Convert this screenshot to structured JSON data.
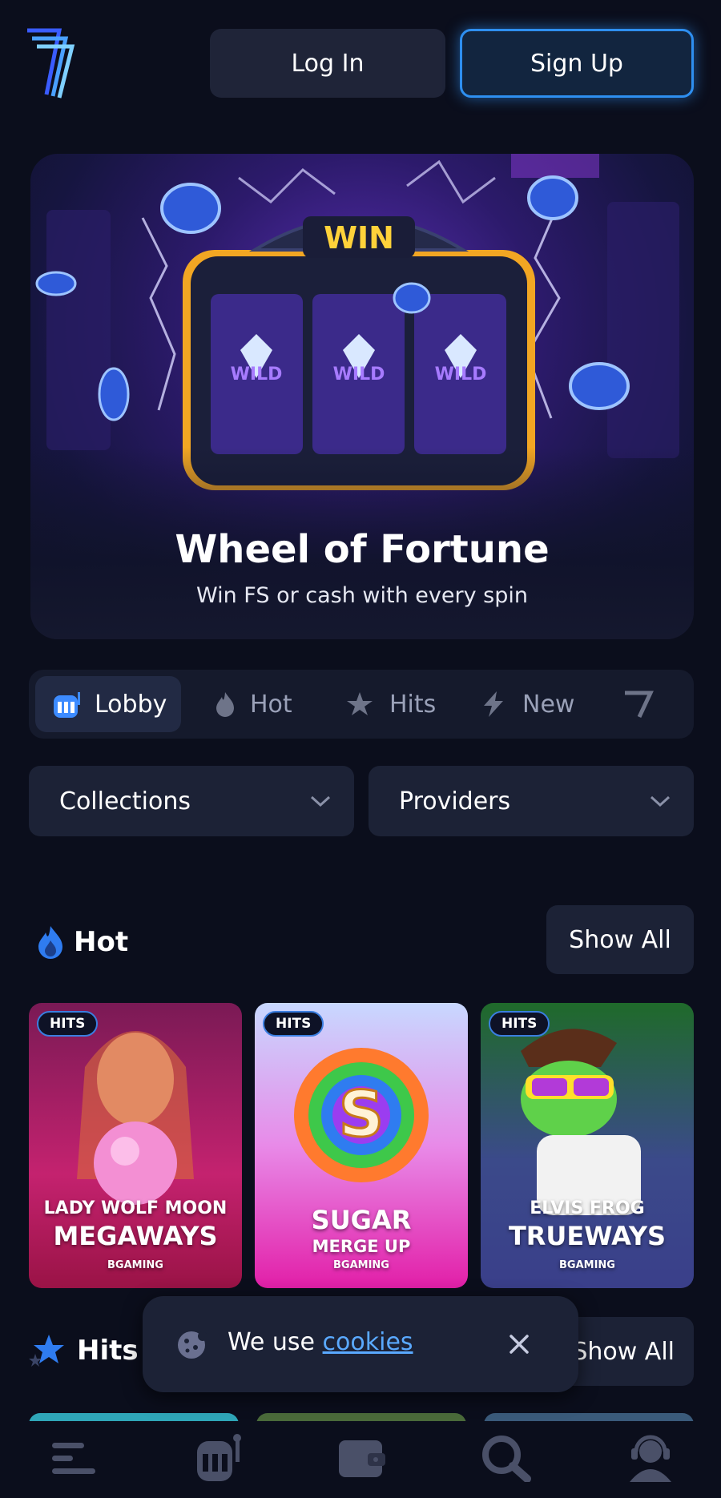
{
  "header": {
    "login_label": "Log In",
    "signup_label": "Sign Up",
    "accent_color": "#2e8ff0"
  },
  "banner": {
    "sign_text": "WIN",
    "reel_text": "WILD",
    "title": "Wheel of Fortune",
    "subtitle": "Win FS or cash with every spin"
  },
  "tabs": [
    {
      "label": "Lobby",
      "icon": "slot-machine-icon",
      "active": true
    },
    {
      "label": "Hot",
      "icon": "flame-icon",
      "active": false
    },
    {
      "label": "Hits",
      "icon": "stars-icon",
      "active": false
    },
    {
      "label": "New",
      "icon": "lightning-icon",
      "active": false
    }
  ],
  "filters": {
    "collections_label": "Collections",
    "providers_label": "Providers"
  },
  "sections": {
    "hot": {
      "title": "Hot",
      "show_all_label": "Show All"
    },
    "hits": {
      "title": "Hits",
      "show_all_label": "Show All"
    }
  },
  "games": [
    {
      "badge": "HITS",
      "line1": "LADY WOLF MOON",
      "line2": "MEGAWAYS",
      "provider": "BGAMING"
    },
    {
      "badge": "HITS",
      "line1": "SUGAR",
      "line2": "MERGE UP",
      "provider": "BGAMING"
    },
    {
      "badge": "HITS",
      "line1": "ELVIS FROG",
      "line2": "TRUEWAYS",
      "provider": "BGAMING"
    }
  ],
  "cookie": {
    "text": "We use",
    "link_label": "cookies"
  },
  "bottom_nav": [
    {
      "icon": "menu-icon"
    },
    {
      "icon": "slot-machine-icon"
    },
    {
      "icon": "wallet-icon"
    },
    {
      "icon": "search-icon"
    },
    {
      "icon": "support-agent-icon"
    }
  ]
}
